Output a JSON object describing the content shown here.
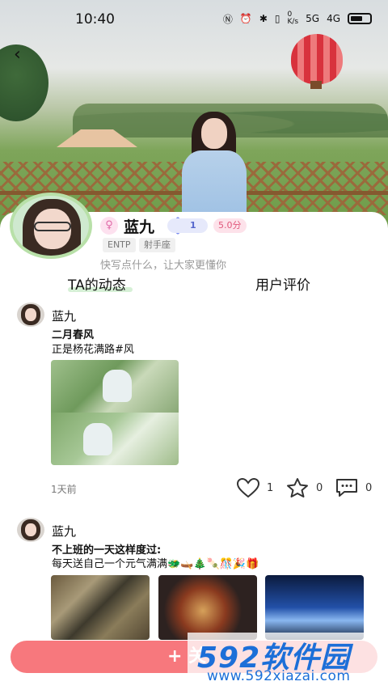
{
  "status_bar": {
    "time": "10:40",
    "net_speed": "0\nK/s",
    "signal1": "5G",
    "signal2": "4G"
  },
  "profile": {
    "nickname": "蓝九",
    "gender_symbol": "♀",
    "level": "1",
    "score": "5.0分",
    "tags": [
      "ENTP",
      "射手座"
    ],
    "bio": "快写点什么，让大家更懂你"
  },
  "tabs": [
    {
      "label": "TA的动态",
      "active": true
    },
    {
      "label": "用户评价",
      "active": false
    }
  ],
  "posts": [
    {
      "author": "蓝九",
      "title": "二月春风",
      "text": "正是杨花满路#风",
      "time_ago": "1天前",
      "likes": "1",
      "favorites": "0",
      "comments": "0"
    },
    {
      "author": "蓝九",
      "title": "不上班的一天这样度过:",
      "text": "每天送自己一个元气满满🐲🛶🎄🍡🎊🎉🎁"
    }
  ],
  "bottom": {
    "button_label": "+ 关"
  },
  "watermark": {
    "logo": "592软件园",
    "url": "www.592xiazai.com"
  },
  "colors": {
    "accent": "#f7787d",
    "avatar_ring": "#b8e0a8",
    "tab_underline": "#d6f0d6",
    "watermark": "#1c6fd8"
  }
}
